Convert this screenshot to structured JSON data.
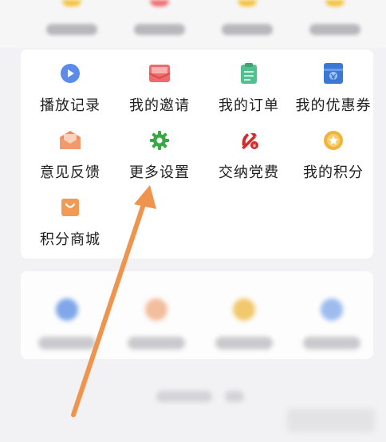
{
  "menu": {
    "items": [
      {
        "key": "play-history",
        "label": "播放记录",
        "icon": "play-circle-icon",
        "color": "#5b8de8"
      },
      {
        "key": "my-invitation",
        "label": "我的邀请",
        "icon": "envelope-icon",
        "color": "#ef6b6b"
      },
      {
        "key": "my-orders",
        "label": "我的订单",
        "icon": "clipboard-icon",
        "color": "#52c08e"
      },
      {
        "key": "my-coupons",
        "label": "我的优惠券",
        "icon": "coupon-icon",
        "color": "#3b78d6"
      },
      {
        "key": "feedback",
        "label": "意见反馈",
        "icon": "open-envelope-icon",
        "color": "#f0885a"
      },
      {
        "key": "more-settings",
        "label": "更多设置",
        "icon": "gear-icon",
        "color": "#3aa845"
      },
      {
        "key": "party-fee",
        "label": "交纳党费",
        "icon": "party-emblem-icon",
        "color": "#d32a2a"
      },
      {
        "key": "my-points",
        "label": "我的积分",
        "icon": "points-coin-icon",
        "color": "#f2b33a"
      },
      {
        "key": "points-mall",
        "label": "积分商城",
        "icon": "shopping-bag-icon",
        "color": "#f29a52"
      }
    ]
  },
  "annotation": {
    "arrow_color": "#f0944d",
    "points_to": "more-settings"
  }
}
